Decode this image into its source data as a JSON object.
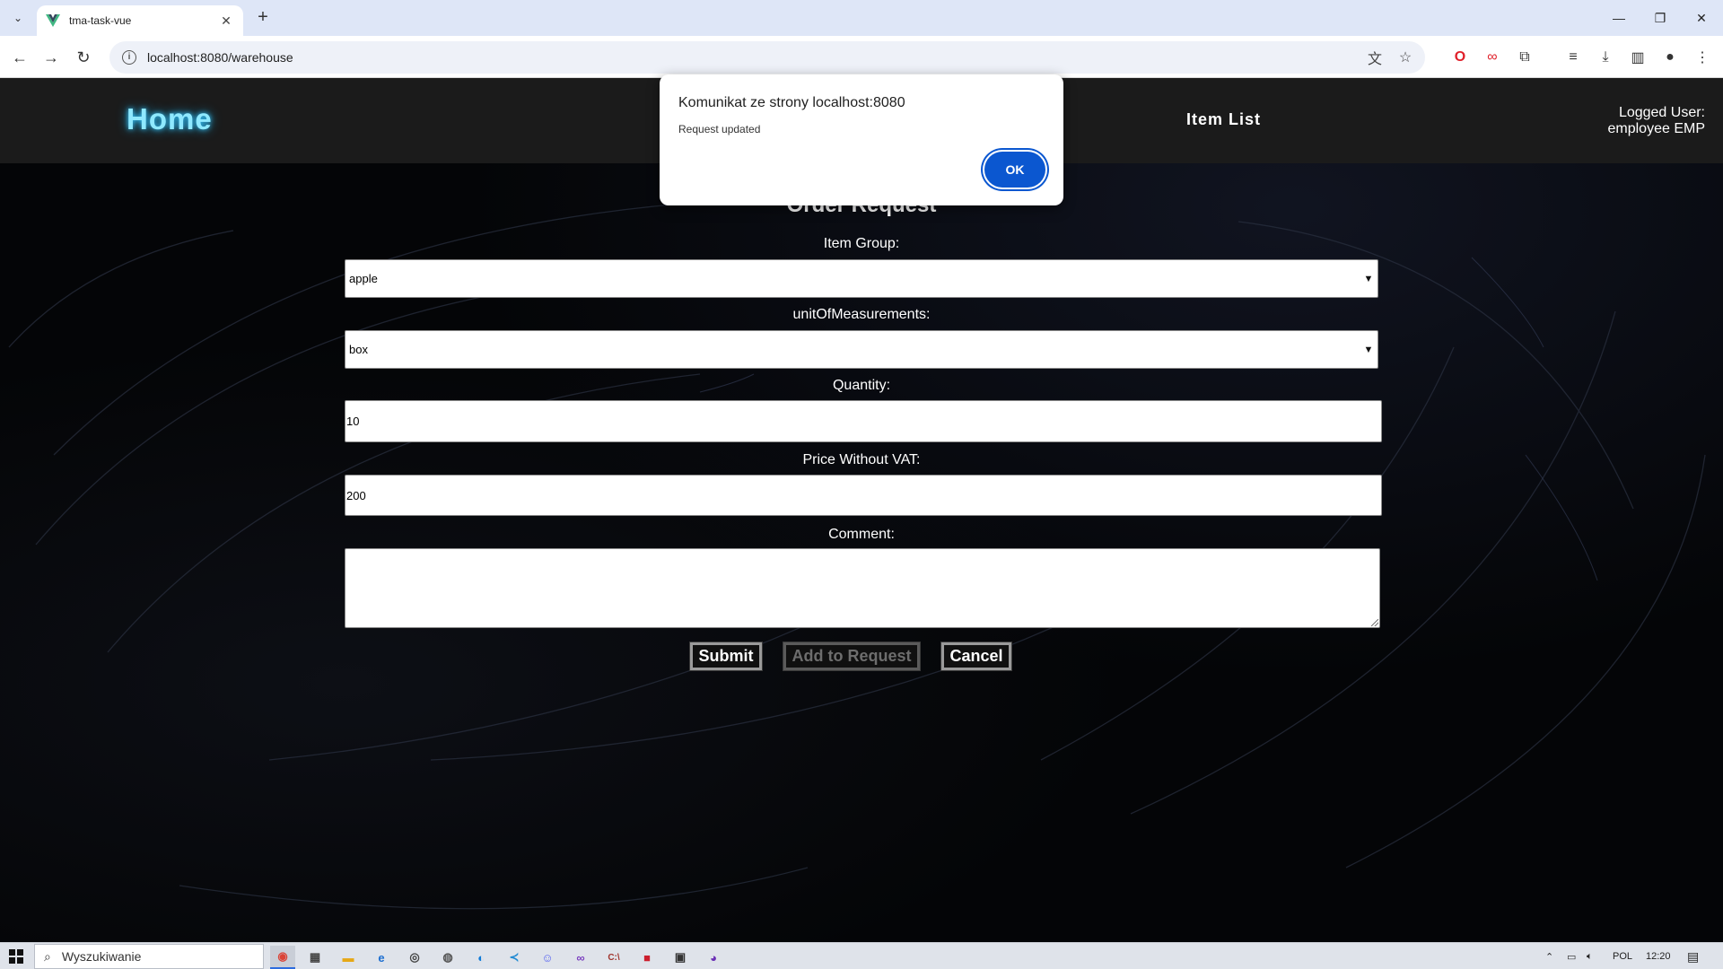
{
  "browser": {
    "tab_title": "tma-task-vue",
    "url": "localhost:8080/warehouse"
  },
  "header": {
    "home_label": "Home",
    "item_list_label": "Item List",
    "logged_user_line1": "Logged User:",
    "logged_user_line2": "employee EMP"
  },
  "form": {
    "title": "Order Request",
    "item_group_label": "Item Group:",
    "item_group_value": "apple",
    "unit_label": "unitOfMeasurements:",
    "unit_value": "box",
    "quantity_label": "Quantity:",
    "quantity_value": "10",
    "price_label": "Price Without VAT:",
    "price_value": "200",
    "comment_label": "Comment:",
    "comment_value": "",
    "submit_label": "Submit",
    "add_label": "Add to Request",
    "cancel_label": "Cancel"
  },
  "dialog": {
    "title": "Komunikat ze strony localhost:8080",
    "message": "Request updated",
    "ok_label": "OK"
  },
  "taskbar": {
    "search_placeholder": "Wyszukiwanie",
    "language": "POL",
    "time": "12:20"
  },
  "colors": {
    "home_glow": "#8fe9ff",
    "dialog_button": "#0b57d0",
    "header_bg": "#1b1b1b"
  }
}
